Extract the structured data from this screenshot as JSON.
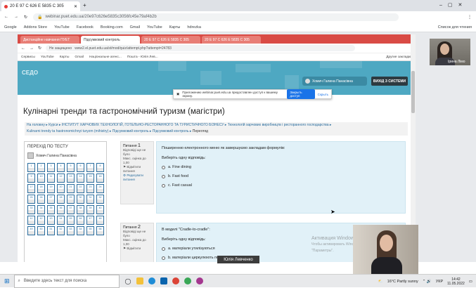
{
  "outer": {
    "tab_title": "20 E 97 C 626 E 5835 C 305",
    "url": "webinar.puet.edu.ua/20e97c626e5835c3056fc45e79af4b2b",
    "bookmarks": [
      "Google",
      "Addons Store",
      "YouTube",
      "Facebook",
      "Booking.com",
      "Gmail",
      "YouTube",
      "Карты",
      "hdrezka"
    ],
    "reading_list": "Список для чтения"
  },
  "inner": {
    "tabs": [
      "Дистанційне навчання ПУЕТ",
      "Підсумковий контроль",
      "20 E 97 C 626 E 5835 C 305",
      "20 E 97 C 626 E 5835 C 305"
    ],
    "insecure_label": "Не защищено",
    "url": "www2.el.puet.edu.ua/st/mod/quiz/attempt.php?attempt=24783",
    "bookmarks": [
      "Сервисы",
      "YouTube",
      "Карты",
      "Gmail",
      "Національне агенс...",
      "Пошта - Юлія Лев..."
    ],
    "other_bookmarks": "Другие закладки"
  },
  "site": {
    "logo": "СЕДО",
    "user_name": "Хомич Галина Панасівна",
    "exit_label": "ВИХІД З СИСТЕМИ",
    "notification": {
      "text": "Приложению webinar.puet.edu.ua предоставлен доступ к вашему экрану.",
      "stop": "Закрыть доступ",
      "hide": "Скрыть"
    },
    "course_title": "Кулінарні тренди та гастрономічний туризм (магістри)",
    "breadcrumbs": [
      "На головну",
      "Курси",
      "ІНСТИТУТ ХАРЧОВИХ ТЕХНОЛОГІЙ, ГОТЕЛЬНО-РЕСТОРАННОГО ТА ТУРИСТИЧНОГО БІЗНЕСУ",
      "Технологій харчових виробництв і ресторанного господарства",
      "Kulinarni trendy ta hastronomichnyi turyzm (mihistry)",
      "Підсумковий контроль",
      "Підсумковий контроль",
      "Перегляд"
    ]
  },
  "sidebar": {
    "title": "ПЕРЕХІД ПО ТЕСТУ",
    "user": "Хомич Галина Панасівна",
    "question_numbers": [
      1,
      2,
      3,
      4,
      5,
      6,
      7,
      8,
      9,
      10,
      11,
      12,
      13,
      14,
      15,
      16,
      17,
      18,
      19,
      20,
      21,
      22,
      23,
      24,
      25,
      26,
      27,
      28,
      29,
      30,
      31,
      32,
      33,
      34,
      35,
      36,
      37,
      38,
      39,
      40,
      41,
      42,
      43,
      44,
      45,
      46,
      47,
      48,
      49,
      50,
      51,
      52,
      53,
      54,
      55,
      56
    ]
  },
  "questions": [
    {
      "label": "Питання",
      "number": "1",
      "status": "Відповіді ще не було",
      "grade": "Макс. оцінка до 1,00",
      "flag": "Відмітити питання",
      "edit": "Редагувати питання",
      "text": "Поширенню електронного меню як завершуємо закладам формулів:",
      "prompt": "Виберіть одну відповідь:",
      "options": [
        "a. Fine dining",
        "b. Fast food",
        "c. Fast casual"
      ]
    },
    {
      "label": "Питання",
      "number": "2",
      "status": "Відповіді ще не було",
      "grade": "Макс. оцінка до 1,00",
      "flag": "Відмітити",
      "text": "В моделі \"Cradle-to-cradle\":",
      "prompt": "Виберіть одну відповідь:",
      "options": [
        "a. матеріали утилізуються",
        "b. матеріали циркулюють по замкнутому циклу"
      ]
    }
  ],
  "watermark": {
    "line1": "Активация Windows",
    "line2": "Чтобы активировать Windows, перейдите в раздел \"Параметры\"."
  },
  "cams": {
    "top_name": "Ірина Лімо",
    "speaker_name": "Юлія Левченко"
  },
  "taskbar": {
    "search_placeholder": "Введите здесь текст для поиска",
    "weather": "16°C  Partly sunny",
    "lang": "УКР",
    "time": "14:42",
    "date": "11.05.2022"
  }
}
